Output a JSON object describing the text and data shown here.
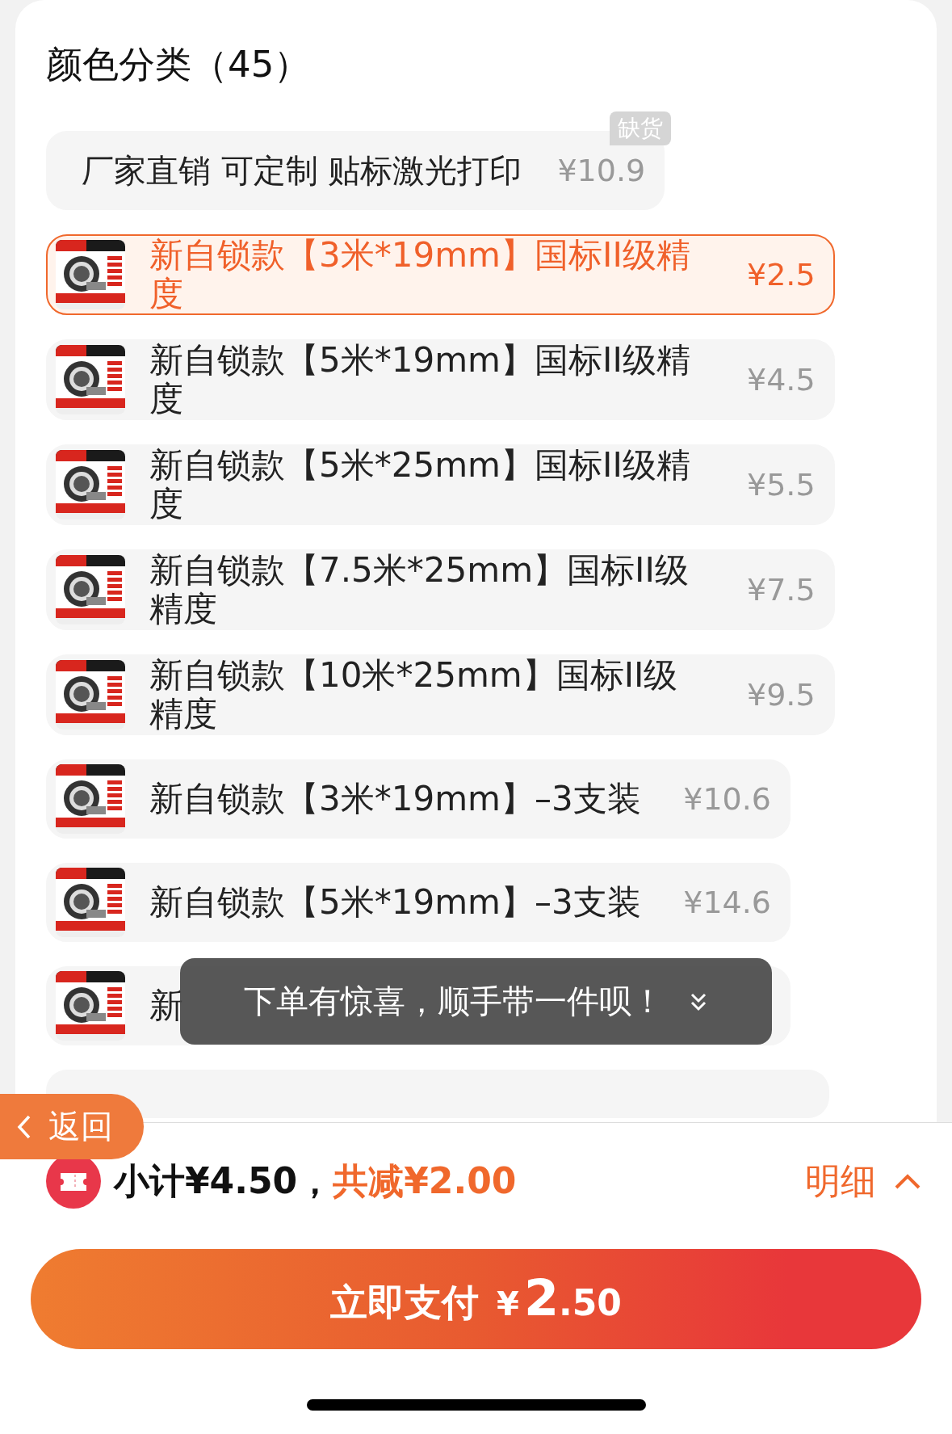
{
  "header": {
    "title": "颜色分类（45）"
  },
  "options": [
    {
      "kind": "text-only",
      "name": "厂家直销 可定制 贴标激光打印",
      "price": "¥10.9",
      "badge": "缺货",
      "selected": false
    },
    {
      "kind": "thumbnail",
      "name": "新自锁款【3米*19mm】国标II级精度",
      "price": "¥2.5",
      "selected": true
    },
    {
      "kind": "thumbnail",
      "name": "新自锁款【5米*19mm】国标II级精度",
      "price": "¥4.5",
      "selected": false
    },
    {
      "kind": "thumbnail",
      "name": "新自锁款【5米*25mm】国标II级精度",
      "price": "¥5.5",
      "selected": false
    },
    {
      "kind": "thumbnail",
      "name": "新自锁款【7.5米*25mm】国标II级精度",
      "price": "¥7.5",
      "selected": false
    },
    {
      "kind": "thumbnail",
      "name": "新自锁款【10米*25mm】国标II级精度",
      "price": "¥9.5",
      "selected": false
    },
    {
      "kind": "thumbnail",
      "name": "新自锁款【3米*19mm】–3支装",
      "price": "¥10.6",
      "selected": false
    },
    {
      "kind": "thumbnail",
      "name": "新自锁款【5米*19mm】–3支装",
      "price": "¥14.6",
      "selected": false
    },
    {
      "kind": "thumbnail",
      "name": "新",
      "selected": false
    }
  ],
  "toast": {
    "text": "下单有惊喜，顺手带一件呗！"
  },
  "back_button": {
    "label": "返回"
  },
  "summary": {
    "subtotal": "小计¥4.50，",
    "discount": "共减¥2.00",
    "details": "明细"
  },
  "pay_button": {
    "label": "立即支付",
    "currency": "¥",
    "amount_int": "2",
    "amount_dec": ".50"
  }
}
